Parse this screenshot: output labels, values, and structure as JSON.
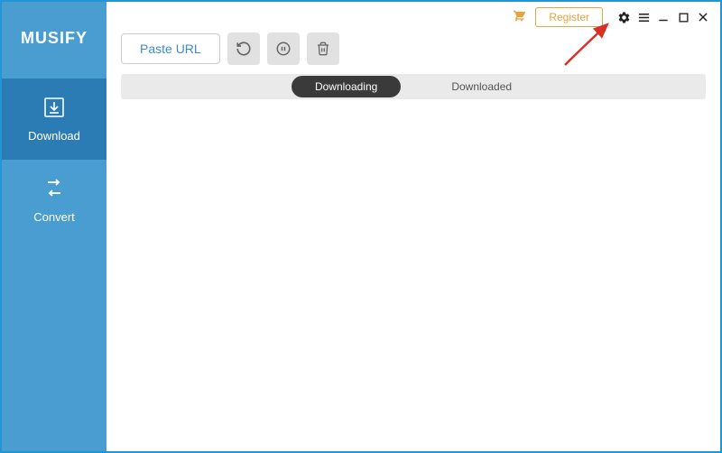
{
  "app": {
    "name": "MUSIFY"
  },
  "sidebar": {
    "items": [
      {
        "label": "Download",
        "icon": "download-box-icon",
        "active": true
      },
      {
        "label": "Convert",
        "icon": "convert-arrows-icon",
        "active": false
      }
    ]
  },
  "titlebar": {
    "register_label": "Register"
  },
  "toolbar": {
    "paste_label": "Paste URL"
  },
  "tabs": {
    "downloading_label": "Downloading",
    "downloaded_label": "Downloaded"
  },
  "colors": {
    "primary_blue": "#4a9dd0",
    "active_blue": "#2b7bb5",
    "accent_orange": "#e8a23f",
    "tab_dark": "#3a3a3a",
    "annotation_red": "#d93025"
  }
}
